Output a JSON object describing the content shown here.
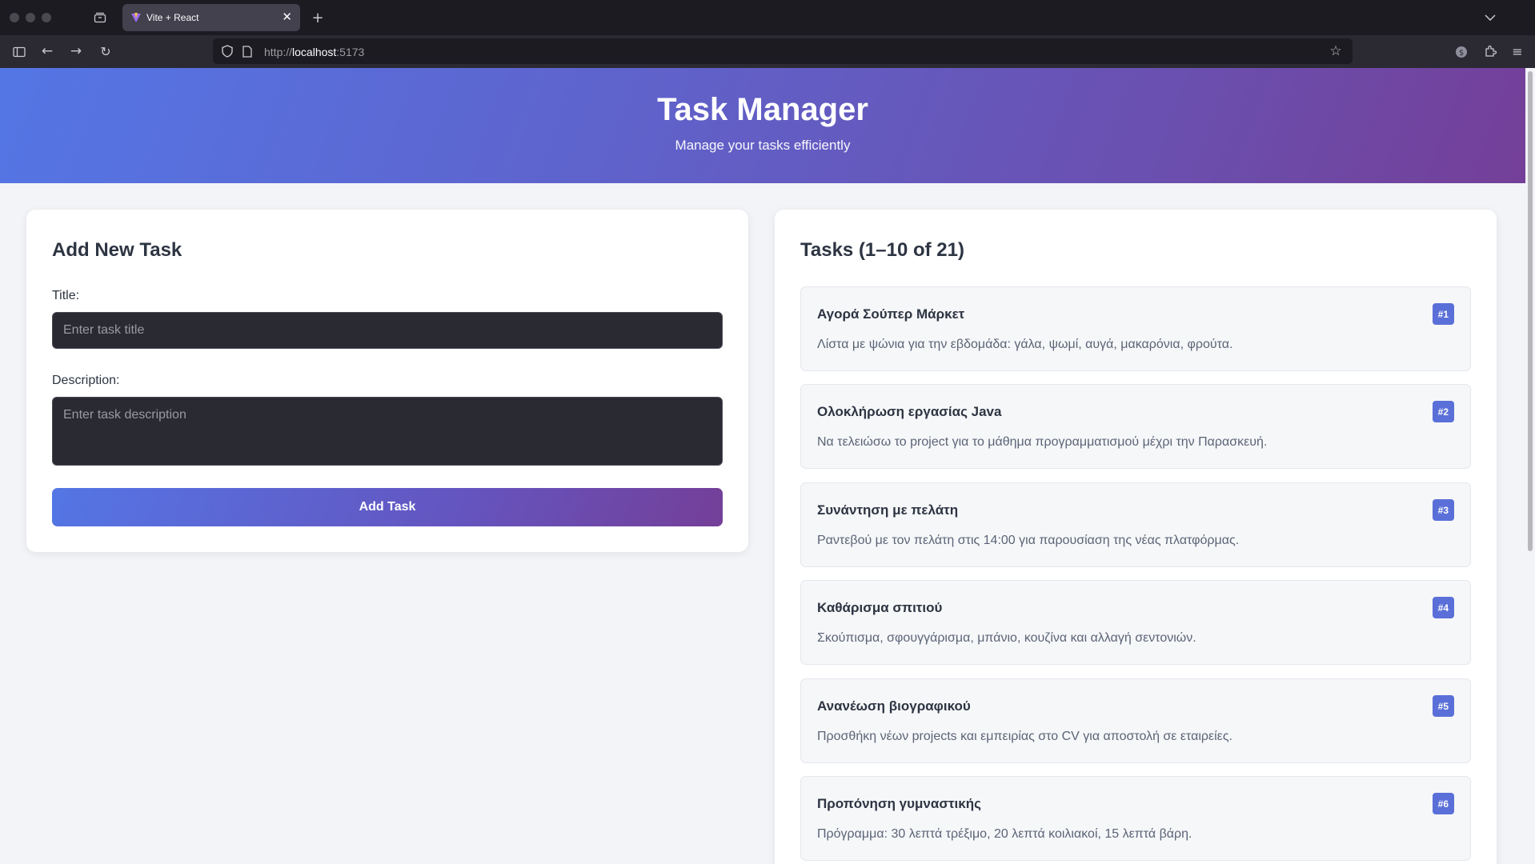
{
  "browser": {
    "tab_title": "Vite + React",
    "url_scheme": "http://",
    "url_host": "localhost",
    "url_port": ":5173"
  },
  "header": {
    "title": "Task Manager",
    "subtitle": "Manage your tasks efficiently"
  },
  "form": {
    "heading": "Add New Task",
    "title_label": "Title:",
    "title_placeholder": "Enter task title",
    "title_value": "",
    "description_label": "Description:",
    "description_placeholder": "Enter task description",
    "description_value": "",
    "submit_label": "Add Task"
  },
  "tasks": {
    "heading": "Tasks (1–10 of 21)",
    "items": [
      {
        "title": "Αγορά Σούπερ Μάρκετ",
        "description": "Λίστα με ψώνια για την εβδομάδα: γάλα, ψωμί, αυγά, μακαρόνια, φρούτα.",
        "badge": "#1"
      },
      {
        "title": "Ολοκλήρωση εργασίας Java",
        "description": "Να τελειώσω το project για το μάθημα προγραμματισμού μέχρι την Παρασκευή.",
        "badge": "#2"
      },
      {
        "title": "Συνάντηση με πελάτη",
        "description": "Ραντεβού με τον πελάτη στις 14:00 για παρουσίαση της νέας πλατφόρμας.",
        "badge": "#3"
      },
      {
        "title": "Καθάρισμα σπιτιού",
        "description": "Σκούπισμα, σφουγγάρισμα, μπάνιο, κουζίνα και αλλαγή σεντονιών.",
        "badge": "#4"
      },
      {
        "title": "Ανανέωση βιογραφικού",
        "description": "Προσθήκη νέων projects και εμπειρίας στο CV για αποστολή σε εταιρείες.",
        "badge": "#5"
      },
      {
        "title": "Προπόνηση γυμναστικής",
        "description": "Πρόγραμμα: 30 λεπτά τρέξιμο, 20 λεπτά κοιλιακοί, 15 λεπτά βάρη.",
        "badge": "#6"
      }
    ]
  },
  "colors": {
    "accent": "#5a6fd8",
    "gradient_start": "#5476e5",
    "gradient_end": "#743f98",
    "page_background": "#f2f4f7"
  }
}
